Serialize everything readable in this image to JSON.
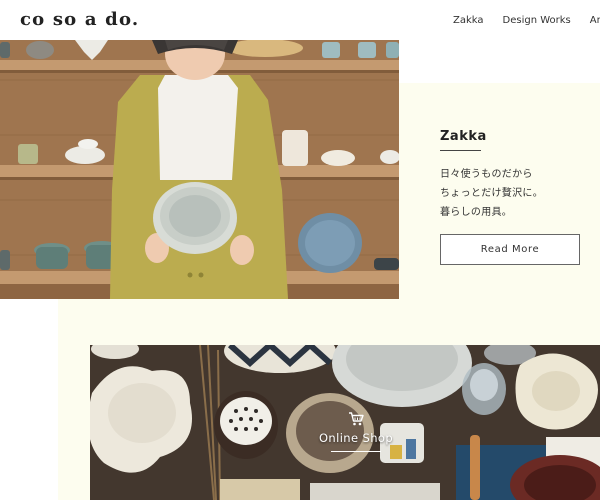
{
  "header": {
    "logo": "co so a do.",
    "nav": [
      "Zakka",
      "Design Works",
      "An"
    ]
  },
  "zakka": {
    "title": "Zakka",
    "body_lines": [
      "日々使うものだから",
      "ちょっとだけ贅沢に。",
      "暮らしの用具。"
    ],
    "button_label": "Read More"
  },
  "shop": {
    "label": "Online Shop",
    "icon": "cart-icon"
  },
  "colors": {
    "cream_panel": "#fdfdef",
    "text": "#222222",
    "cardigan": "#c2b352",
    "shelf_wood": "#9c7048"
  }
}
